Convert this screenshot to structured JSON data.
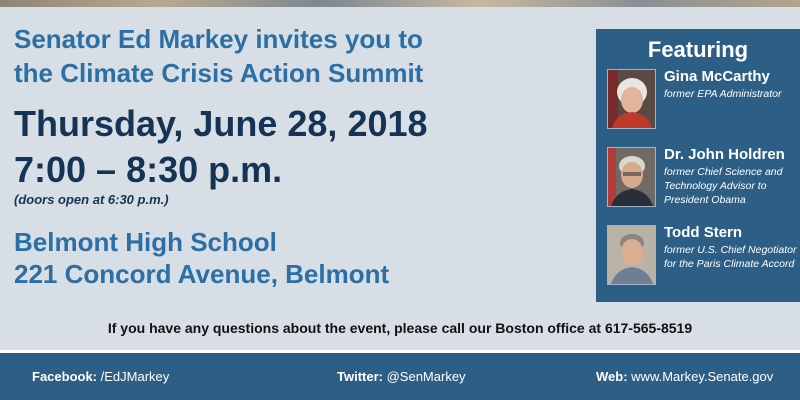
{
  "headline": {
    "line1": "Senator Ed Markey invites you to",
    "line2": "the Climate Crisis Action Summit"
  },
  "event": {
    "date": "Thursday, June 28, 2018",
    "time": "7:00 – 8:30 p.m.",
    "doors": "(doors open at 6:30 p.m.)"
  },
  "venue": {
    "name": "Belmont High School",
    "address": "221 Concord Avenue, Belmont"
  },
  "featuring": {
    "title": "Featuring",
    "speakers": [
      {
        "name": "Gina McCarthy",
        "desc": "former EPA Administrator"
      },
      {
        "name": "Dr. John Holdren",
        "desc": "former Chief Science and Technology Advisor to President Obama"
      },
      {
        "name": "Todd Stern",
        "desc": "former U.S. Chief Negotiator for the Paris Climate Accord"
      }
    ]
  },
  "contact": "If you have any questions about the event, please call our Boston office at 617-565-8519",
  "footer": {
    "facebook": {
      "label": "Facebook:",
      "value": "/EdJMarkey"
    },
    "twitter": {
      "label": "Twitter:",
      "value": "@SenMarkey"
    },
    "web": {
      "label": "Web:",
      "value": "www.Markey.Senate.gov"
    }
  },
  "colors": {
    "background": "#d8dee5",
    "accent_blue": "#2b6fa5",
    "navy": "#153355",
    "panel": "#2d5f86"
  }
}
